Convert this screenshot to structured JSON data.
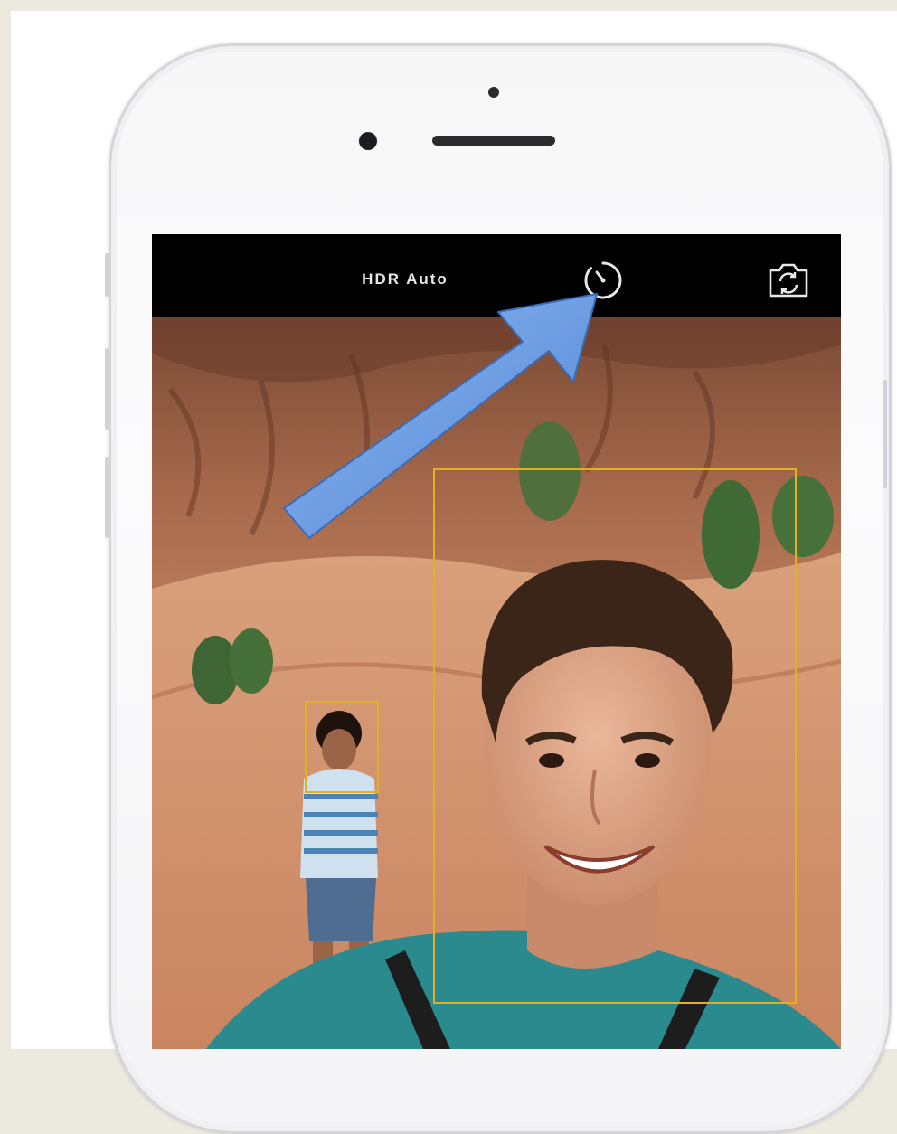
{
  "camera": {
    "hdr_label": "HDR Auto",
    "timer_icon": "timer-icon",
    "flip_icon": "flip-camera-icon"
  },
  "annotation": {
    "arrow_icon": "pointer-arrow",
    "arrow_color": "#6f9de2"
  },
  "colors": {
    "focus_box": "#e3b021",
    "ui_text": "#e6e6e6",
    "phone_body": "#f6f6f7"
  }
}
